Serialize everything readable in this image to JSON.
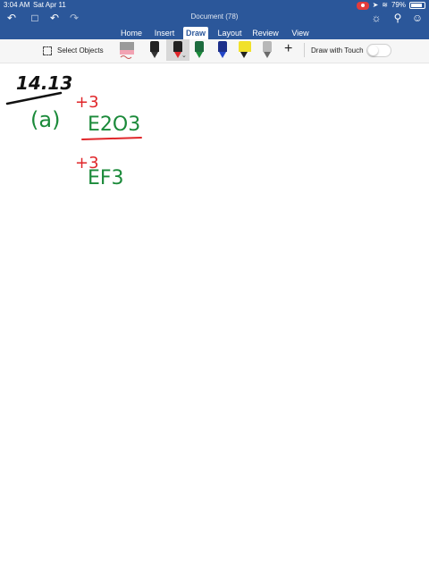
{
  "status_bar": {
    "time": "3:04 AM",
    "date": "Sat Apr 11",
    "battery_percent": "79%",
    "battery_level": 0.79
  },
  "header": {
    "title": "Document (78)",
    "icons": [
      "back-icon",
      "file-icon",
      "undo-icon",
      "redo-icon",
      "lightbulb-icon",
      "search-icon",
      "add-person-icon"
    ]
  },
  "tabs": [
    {
      "label": "Home",
      "active": false
    },
    {
      "label": "Insert",
      "active": false
    },
    {
      "label": "Draw",
      "active": true
    },
    {
      "label": "Layout",
      "active": false
    },
    {
      "label": "Review",
      "active": false
    },
    {
      "label": "View",
      "active": false
    }
  ],
  "toolbar": {
    "select_label": "Select Objects",
    "draw_touch_label": "Draw with Touch",
    "draw_touch_on": false
  },
  "ink_colors": {
    "black": "#111111",
    "red": "#e0262a",
    "green": "#1b8a3a"
  },
  "ink_text": {
    "heading": "14.13",
    "part": "(a)",
    "formula1": "E2O3",
    "charge1": "+3",
    "formula2": "EF3",
    "charge2": "+3"
  },
  "colors": {
    "ribbon": "#2b579a",
    "toolbar_bg": "#f6f6f6"
  }
}
